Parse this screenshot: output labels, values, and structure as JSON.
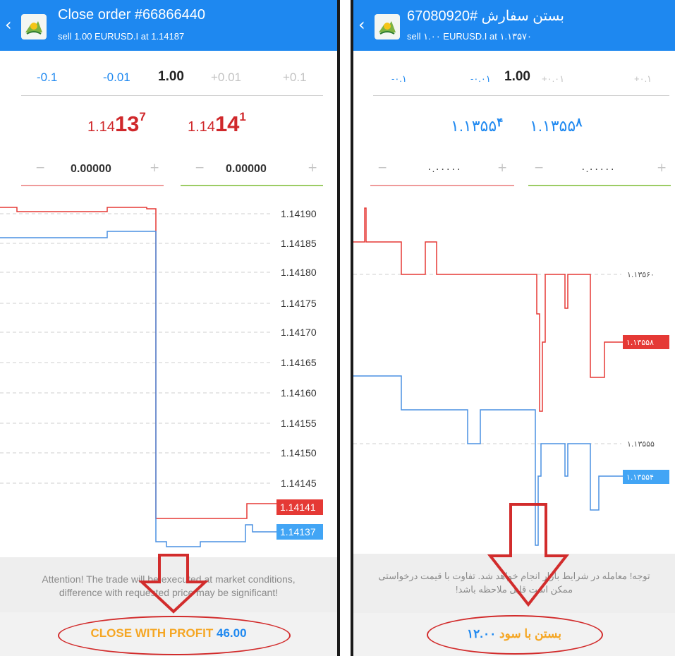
{
  "left": {
    "header": {
      "title": "Close order #66866440",
      "subtitle": "sell 1.00 EURUSD.I at 1.14187"
    },
    "volume": {
      "minus_big": "-0.1",
      "minus_small": "-0.01",
      "current": "1.00",
      "plus_small": "+0.01",
      "plus_big": "+0.1"
    },
    "bid": {
      "prefix": "1.14",
      "big": "13",
      "sup": "7"
    },
    "ask": {
      "prefix": "1.14",
      "big": "14",
      "sup": "1"
    },
    "stop_loss": {
      "minus": "−",
      "value": "0.00000",
      "plus": "+"
    },
    "take_profit": {
      "minus": "−",
      "value": "0.00000",
      "plus": "+"
    },
    "chart": {
      "y_labels": [
        "1.14190",
        "1.14185",
        "1.14180",
        "1.14175",
        "1.14170",
        "1.14165",
        "1.14160",
        "1.14155",
        "1.14150",
        "1.14145"
      ],
      "ask_tag": "1.14141",
      "bid_tag": "1.14137"
    },
    "notice": {
      "line1": "Attention! The trade will be executed at market conditions,",
      "line2": "difference with requested price may be significant!"
    },
    "close_button": {
      "text": "CLOSE WITH PROFIT",
      "value": "46.00"
    }
  },
  "right": {
    "header": {
      "title": "بستن سفارش #67080920",
      "subtitle": "sell ۱.۰۰ EURUSD.I at ۱.۱۳۵۷۰"
    },
    "volume": {
      "minus_big": "-۰.۱",
      "minus_small": "-۰.۰۱",
      "current": "1.00",
      "plus_small": "+۰.۰۱",
      "plus_big": "+۰.۱"
    },
    "bid": {
      "text": "۱.۱۳۵۵",
      "sup": "۴"
    },
    "ask": {
      "text": "۱.۱۳۵۵",
      "sup": "۸"
    },
    "stop_loss": {
      "minus": "−",
      "value": "۰.۰۰۰۰۰",
      "plus": "+"
    },
    "take_profit": {
      "minus": "−",
      "value": "۰.۰۰۰۰۰",
      "plus": "+"
    },
    "chart": {
      "y_labels": [
        "۱.۱۳۵۶۰",
        "۱.۱۳۵۵۵"
      ],
      "ask_tag": "۱.۱۳۵۵۸",
      "bid_tag": "۱.۱۳۵۵۴"
    },
    "notice": {
      "line1": "توجه! معامله در شرایط بازار انجام خواهد شد. تفاوت با قیمت درخواستی",
      "line2": "ممکن است قابل ملاحظه باشد!"
    },
    "close_button": {
      "text": "بستن با سود",
      "value": "۱۲.۰۰"
    }
  },
  "colors": {
    "header": "#1e88f0",
    "ask": "#d0282b",
    "bid": "#1e88f0",
    "profit_text": "#f5a623",
    "annotation": "#d22c2c"
  },
  "icons": [
    "chevron-left-icon",
    "metatrader-logo-icon",
    "annotation-arrow-icon"
  ]
}
